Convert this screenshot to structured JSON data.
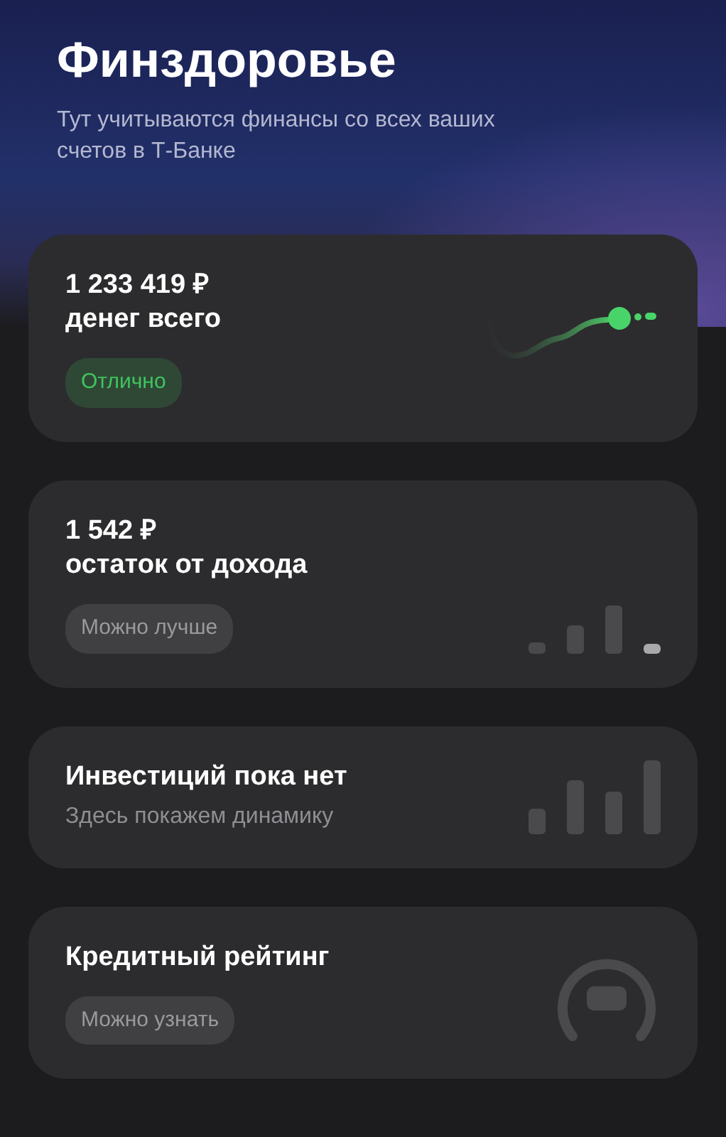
{
  "header": {
    "title": "Финздоровье",
    "subtitle": "Тут учитываются финансы со всех ваших счетов в Т-Банке"
  },
  "cards": [
    {
      "kind": "trend",
      "amount": "1 233 419 ₽",
      "title": "денег всего",
      "badge": {
        "text": "Отлично",
        "color": "#3fc45c"
      }
    },
    {
      "kind": "bars-last",
      "amount": "1 542 ₽",
      "title": "остаток от дохода",
      "badge": {
        "text": "Можно лучше",
        "color": "#9a9a9e"
      }
    },
    {
      "kind": "bars",
      "title": "Инвестиций пока нет",
      "subtitle": "Здесь покажем динамику"
    },
    {
      "kind": "gauge",
      "title": "Кредитный рейтинг",
      "badge": {
        "text": "Можно узнать",
        "color": "#9a9a9e"
      }
    }
  ]
}
